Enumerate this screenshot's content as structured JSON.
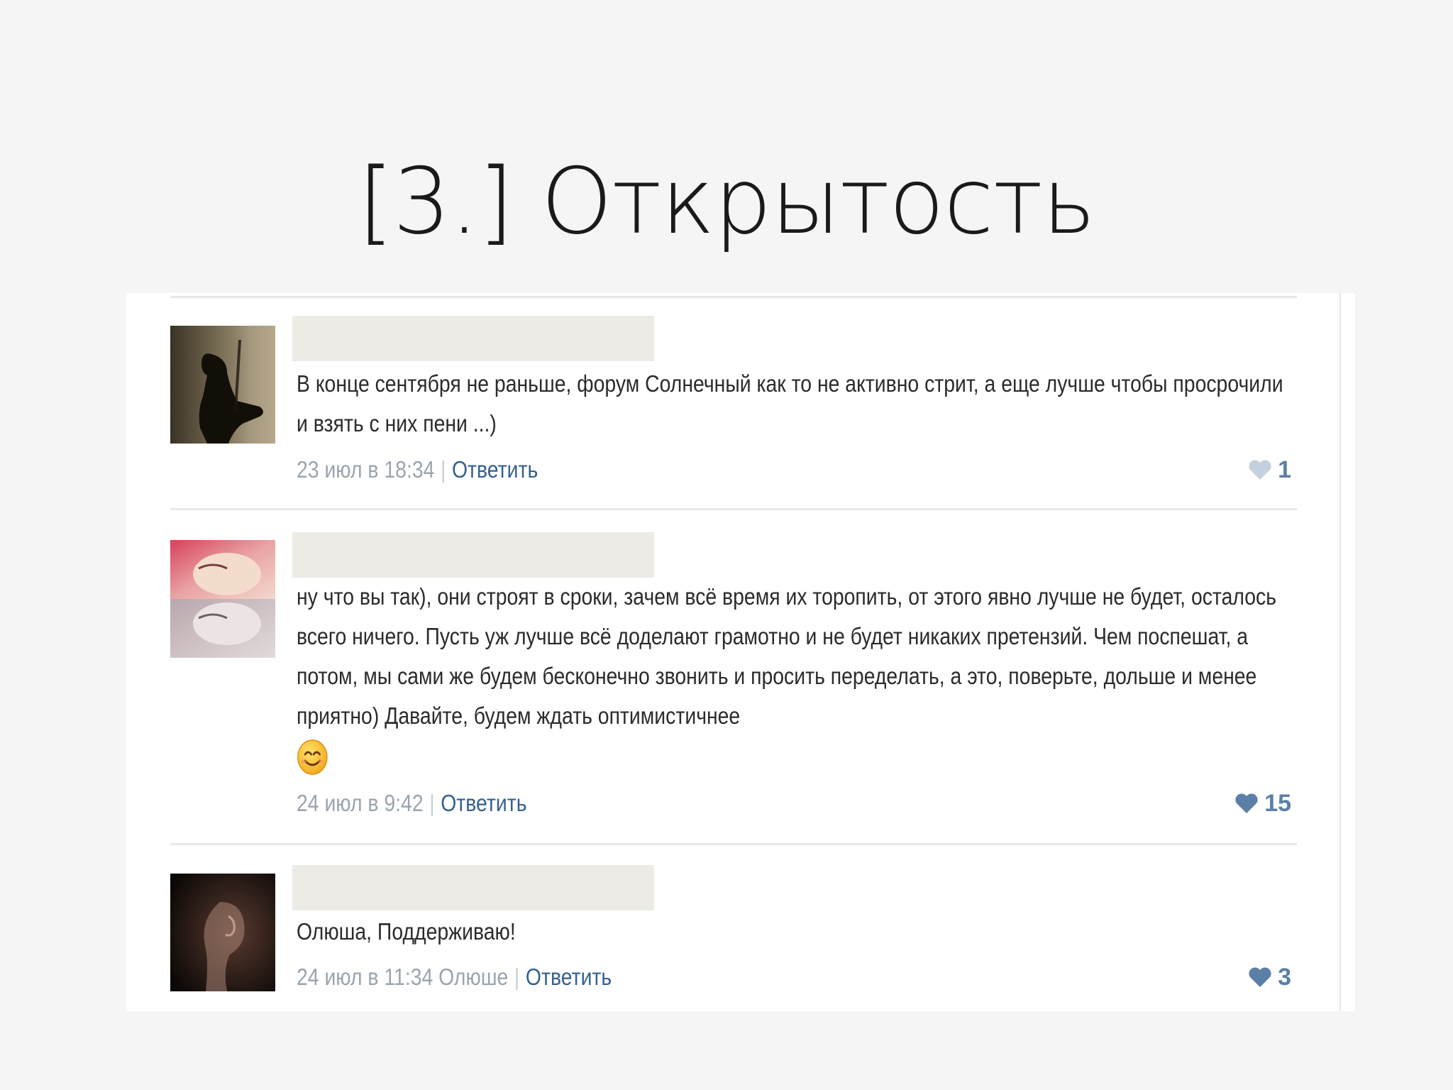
{
  "slide": {
    "title": "[3.] Открытость"
  },
  "comments": [
    {
      "text": "В конце сентября не раньше, форум Солнечный как то не активно стрит, а еще лучше чтобы просрочили и взять с них пени ...)",
      "date": "23 июл в 18:34",
      "reply_label": "Ответить",
      "likes": "1",
      "like_state": "inactive"
    },
    {
      "text": "ну что вы так), они строят в сроки, зачем всё время их торопить, от этого явно лучше не будет, осталось всего ничего. Пусть уж лучше всё доделают грамотно и не будет никаких претензий. Чем поспешат, а потом, мы сами же будем бесконечно звонить и просить переделать, а это, поверьте, дольше и менее приятно) Давайте, будем ждать оптимистичнее",
      "emoji": "smiling-face-icon",
      "date": "24 июл в 9:42",
      "reply_label": "Ответить",
      "likes": "15",
      "like_state": "active"
    },
    {
      "text": "Олюша, Поддерживаю!",
      "date": "24 июл в 11:34 Олюше",
      "reply_label": "Ответить",
      "likes": "3",
      "like_state": "active"
    }
  ],
  "colors": {
    "link": "#35618f",
    "meta_gray": "#9aa4ae",
    "like_active": "#5b7fa6",
    "like_inactive": "#c3d1de"
  }
}
